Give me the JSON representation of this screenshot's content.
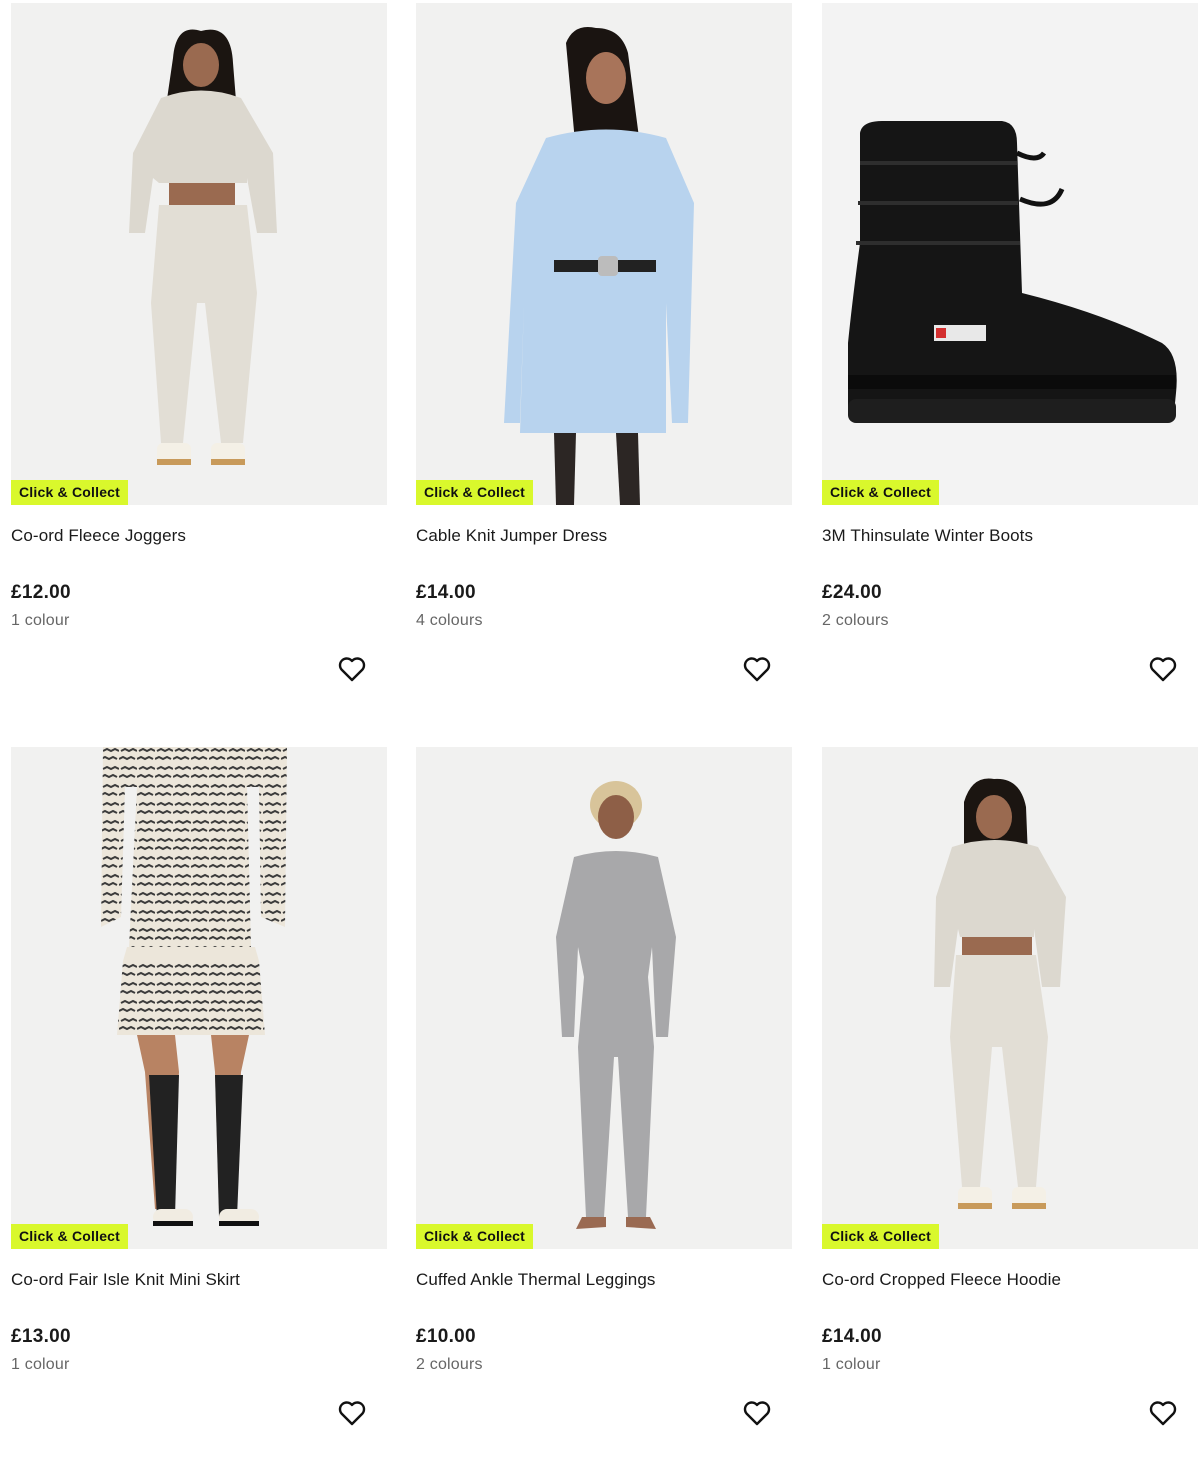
{
  "products": [
    {
      "badge": "Click & Collect",
      "title": "Co-ord Fleece Joggers",
      "price": "£12.00",
      "colours": "1 colour",
      "image": "woman-cream-fleece-joggers-set",
      "wishlist_icon": "heart-outline-icon"
    },
    {
      "badge": "Click & Collect",
      "title": "Cable Knit Jumper Dress",
      "price": "£14.00",
      "colours": "4 colours",
      "image": "woman-blue-cable-knit-dress",
      "wishlist_icon": "heart-outline-icon"
    },
    {
      "badge": "Click & Collect",
      "title": "3M Thinsulate Winter Boots",
      "price": "£24.00",
      "colours": "2 colours",
      "image": "black-quilted-snow-boot",
      "wishlist_icon": "heart-outline-icon"
    },
    {
      "badge": "Click & Collect",
      "title": "Co-ord Fair Isle Knit Mini Skirt",
      "price": "£13.00",
      "colours": "1 colour",
      "image": "fair-isle-knit-skirt-outfit",
      "wishlist_icon": "heart-outline-icon"
    },
    {
      "badge": "Click & Collect",
      "title": "Cuffed Ankle Thermal Leggings",
      "price": "£10.00",
      "colours": "2 colours",
      "image": "woman-grey-thermal-set",
      "wishlist_icon": "heart-outline-icon"
    },
    {
      "badge": "Click & Collect",
      "title": "Co-ord Cropped Fleece Hoodie",
      "price": "£14.00",
      "colours": "1 colour",
      "image": "woman-cream-cropped-hoodie-set",
      "wishlist_icon": "heart-outline-icon"
    }
  ],
  "colors": {
    "badge_bg": "#d9f82c",
    "image_bg": "#f2f2f2",
    "price_text": "#1a1a1a",
    "muted_text": "#666666"
  }
}
